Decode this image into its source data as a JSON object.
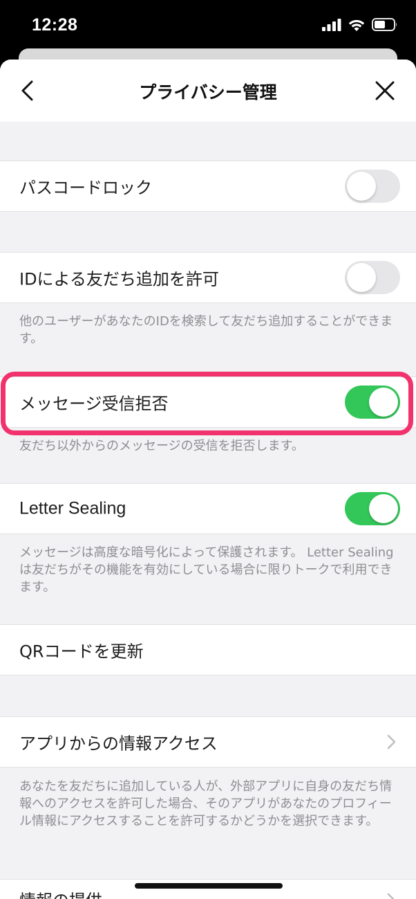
{
  "status_bar": {
    "time": "12:28",
    "icons": [
      "signal-icon",
      "wifi-icon",
      "battery-icon"
    ]
  },
  "nav": {
    "title": "プライバシー管理",
    "back_icon": "chevron-left-icon",
    "close_icon": "close-icon"
  },
  "settings": {
    "passcode_lock": {
      "label": "パスコードロック",
      "enabled": false
    },
    "allow_add_by_id": {
      "label": "IDによる友だち追加を許可",
      "enabled": false,
      "description": "他のユーザーがあなたのIDを検索して友だち追加することができます。"
    },
    "reject_messages": {
      "label": "メッセージ受信拒否",
      "enabled": true,
      "description": "友だち以外からのメッセージの受信を拒否します。"
    },
    "letter_sealing": {
      "label": "Letter Sealing",
      "enabled": true,
      "description": "メッセージは高度な暗号化によって保護されます。 Letter Sealingは友だちがその機能を有効にしている場合に限りトークで利用できます。"
    },
    "qr_refresh": {
      "label": "QRコードを更新"
    },
    "app_info_access": {
      "label": "アプリからの情報アクセス",
      "description": "あなたを友だちに追加している人が、外部アプリに自身の友だち情報へのアクセスを許可した場合、そのアプリがあなたのプロフィール情報にアクセスすることを許可するかどうかを選択できます。"
    },
    "next_item": {
      "label": "情報の提供"
    }
  },
  "colors": {
    "toggle_on": "#33c759",
    "toggle_off": "#e6e6e9",
    "highlight": "#f2326c"
  }
}
